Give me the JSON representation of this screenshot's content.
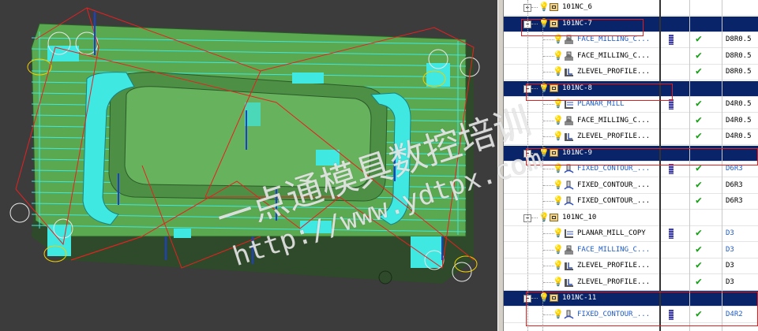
{
  "navigator": {
    "rows": [
      {
        "kind": "group",
        "label": "101NC_6",
        "expander": "+",
        "selected": false
      },
      {
        "kind": "group",
        "label": "101NC-7",
        "expander": "−",
        "selected": true
      },
      {
        "kind": "op",
        "label": "FACE_MILLING_C...",
        "icon": "face-milling-icon",
        "blue": true,
        "bar": true,
        "check": true,
        "tool": "D8R0.5",
        "toolBlue": false
      },
      {
        "kind": "op",
        "label": "FACE_MILLING_C...",
        "icon": "face-milling-icon",
        "blue": false,
        "bar": false,
        "check": true,
        "tool": "D8R0.5",
        "toolBlue": false
      },
      {
        "kind": "op",
        "label": "ZLEVEL_PROFILE...",
        "icon": "zlevel-profile-icon",
        "blue": false,
        "bar": false,
        "check": true,
        "tool": "D8R0.5",
        "toolBlue": false
      },
      {
        "kind": "group",
        "label": "101NC-8",
        "expander": "−",
        "selected": true
      },
      {
        "kind": "op",
        "label": "PLANAR_MILL",
        "icon": "planar-mill-icon",
        "blue": true,
        "bar": true,
        "check": true,
        "tool": "D4R0.5",
        "toolBlue": false
      },
      {
        "kind": "op",
        "label": "FACE_MILLING_C...",
        "icon": "face-milling-icon",
        "blue": false,
        "bar": false,
        "check": true,
        "tool": "D4R0.5",
        "toolBlue": false
      },
      {
        "kind": "op",
        "label": "ZLEVEL_PROFILE...",
        "icon": "zlevel-profile-icon",
        "blue": false,
        "bar": false,
        "check": true,
        "tool": "D4R0.5",
        "toolBlue": false
      },
      {
        "kind": "group",
        "label": "101NC-9",
        "expander": "−",
        "selected": true
      },
      {
        "kind": "op",
        "label": "FIXED_CONTOUR_...",
        "icon": "fixed-contour-icon",
        "blue": true,
        "bar": true,
        "check": true,
        "tool": "D6R3",
        "toolBlue": true
      },
      {
        "kind": "op",
        "label": "FIXED_CONTOUR_...",
        "icon": "fixed-contour-icon",
        "blue": false,
        "bar": false,
        "check": true,
        "tool": "D6R3",
        "toolBlue": false
      },
      {
        "kind": "op",
        "label": "FIXED_CONTOUR_...",
        "icon": "fixed-contour-icon",
        "blue": false,
        "bar": false,
        "check": true,
        "tool": "D6R3",
        "toolBlue": false
      },
      {
        "kind": "group",
        "label": "101NC_10",
        "expander": "−",
        "selected": false
      },
      {
        "kind": "op",
        "label": "PLANAR_MILL_COPY",
        "icon": "planar-mill-icon",
        "blue": false,
        "bar": true,
        "check": true,
        "tool": "D3",
        "toolBlue": true
      },
      {
        "kind": "op",
        "label": "FACE_MILLING_C...",
        "icon": "face-milling-icon",
        "blue": true,
        "bar": false,
        "check": true,
        "tool": "D3",
        "toolBlue": true
      },
      {
        "kind": "op",
        "label": "ZLEVEL_PROFILE...",
        "icon": "zlevel-profile-icon",
        "blue": false,
        "bar": false,
        "check": true,
        "tool": "D3",
        "toolBlue": false
      },
      {
        "kind": "op",
        "label": "ZLEVEL_PROFILE...",
        "icon": "zlevel-profile-icon",
        "blue": false,
        "bar": false,
        "check": true,
        "tool": "D3",
        "toolBlue": false
      },
      {
        "kind": "group",
        "label": "101NC-11",
        "expander": "−",
        "selected": true
      },
      {
        "kind": "op",
        "label": "FIXED_CONTOUR_...",
        "icon": "fixed-contour-icon",
        "blue": true,
        "bar": true,
        "check": true,
        "tool": "D4R2",
        "toolBlue": true
      }
    ]
  },
  "watermark": {
    "line1": "一点通模具数控培训",
    "line2": "http://www.ydtpx.com"
  },
  "colors": {
    "background": "#3c3c3c",
    "part": "#5aaa5a",
    "toolpath": "#32e0e0",
    "rapid": "#e02020",
    "selection": "#0a246a",
    "highlight": "#e02020"
  }
}
